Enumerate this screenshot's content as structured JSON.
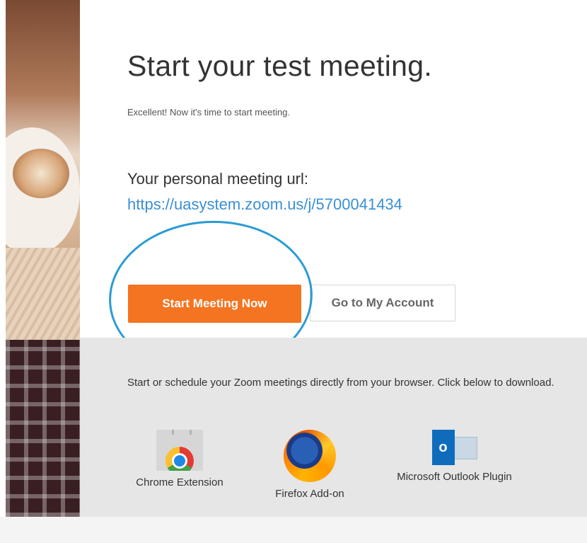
{
  "heading": {
    "title": "Start your test meeting.",
    "subtitle": "Excellent! Now it's time to start meeting."
  },
  "meeting": {
    "url_label": "Your personal meeting url:",
    "url": "https://uasystem.zoom.us/j/5700041434"
  },
  "actions": {
    "start_label": "Start Meeting Now",
    "account_label": "Go to My Account"
  },
  "plugins": {
    "description": "Start or schedule your Zoom meetings directly from your browser. Click below to download.",
    "items": [
      {
        "label": "Chrome Extension",
        "icon": "chrome-webstore-icon"
      },
      {
        "label": "Firefox Add-on",
        "icon": "firefox-icon"
      },
      {
        "label": "Microsoft Outlook Plugin",
        "icon": "outlook-icon"
      }
    ]
  },
  "colors": {
    "accent_orange": "#f47421",
    "link_blue": "#3a8fd6",
    "highlight_circle": "#2a9bd3"
  }
}
